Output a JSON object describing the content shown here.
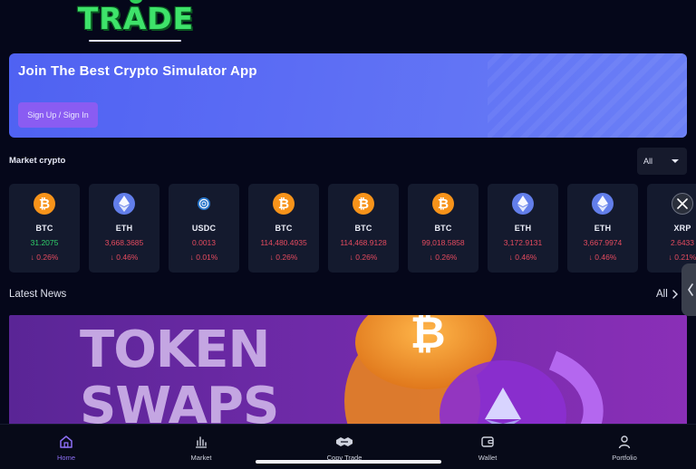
{
  "app": {
    "logo_text": "TRADE"
  },
  "banner": {
    "title": "Join The Best Crypto Simulator App",
    "button_label": "Sign Up / Sign In"
  },
  "market": {
    "title": "Market crypto",
    "filter_value": "All",
    "coins": [
      {
        "symbol": "BTC",
        "price": "31.2075",
        "change": "↓ 0.26%",
        "price_trend": "up",
        "icon": "bitcoin-icon"
      },
      {
        "symbol": "ETH",
        "price": "3,668.3685",
        "change": "↓ 0.46%",
        "price_trend": "down",
        "icon": "ethereum-icon"
      },
      {
        "symbol": "USDC",
        "price": "0.0013",
        "change": "↓ 0.01%",
        "price_trend": "down",
        "icon": "usdc-icon"
      },
      {
        "symbol": "BTC",
        "price": "114,480.4935",
        "change": "↓ 0.26%",
        "price_trend": "down",
        "icon": "bitcoin-icon"
      },
      {
        "symbol": "BTC",
        "price": "114,468.9128",
        "change": "↓ 0.26%",
        "price_trend": "down",
        "icon": "bitcoin-icon"
      },
      {
        "symbol": "BTC",
        "price": "99,018.5858",
        "change": "↓ 0.26%",
        "price_trend": "down",
        "icon": "bitcoin-icon"
      },
      {
        "symbol": "ETH",
        "price": "3,172.9131",
        "change": "↓ 0.46%",
        "price_trend": "down",
        "icon": "ethereum-icon"
      },
      {
        "symbol": "ETH",
        "price": "3,667.9974",
        "change": "↓ 0.46%",
        "price_trend": "down",
        "icon": "ethereum-icon"
      },
      {
        "symbol": "XRP",
        "price": "2.6433",
        "change": "↓ 0.21%",
        "price_trend": "down",
        "icon": "xrp-icon"
      }
    ]
  },
  "news": {
    "title": "Latest News",
    "all_label": "All",
    "image_text_line1": "TOKEN",
    "image_text_line2": "SWAPS"
  },
  "bottom_nav": {
    "items": [
      {
        "label": "Home",
        "icon": "home-icon",
        "active": true
      },
      {
        "label": "Market",
        "icon": "bar-chart-icon",
        "active": false
      },
      {
        "label": "Copy Trade",
        "icon": "handshake-icon",
        "active": false
      },
      {
        "label": "Wallet",
        "icon": "wallet-icon",
        "active": false
      },
      {
        "label": "Portfolio",
        "icon": "user-icon",
        "active": false
      }
    ]
  },
  "colors": {
    "background": "#05071a",
    "banner": "#5b6cf4",
    "accent_purple": "#8a5cf2",
    "price_up": "#2fd06a",
    "price_down": "#e54b5f",
    "bitcoin": "#f7931a",
    "ethereum": "#627eea",
    "usdc": "#2775ca"
  }
}
